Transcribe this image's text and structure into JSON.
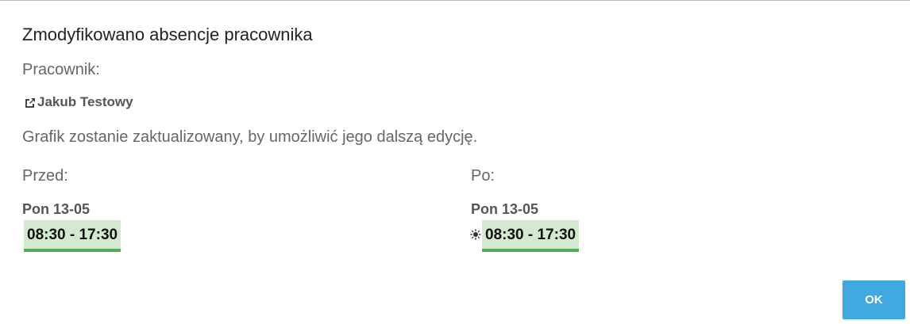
{
  "dialog": {
    "title": "Zmodyfikowano absencje pracownika",
    "employee_label": "Pracownik:",
    "employee_name": "Jakub Testowy",
    "employee_link_icon": "external-link-icon",
    "message": "Grafik zostanie zaktualizowany, by umożliwić jego dalszą edycję.",
    "before": {
      "label": "Przed:",
      "day": "Pon 13-05",
      "shift": "08:30 - 17:30"
    },
    "after": {
      "label": "Po:",
      "day": "Pon 13-05",
      "shift": "08:30 - 17:30",
      "icon": "sun-icon"
    },
    "ok_label": "OK"
  },
  "colors": {
    "shift_background": "#d4ead0",
    "shift_border": "#4caf50",
    "button": "#3fa9e0"
  }
}
